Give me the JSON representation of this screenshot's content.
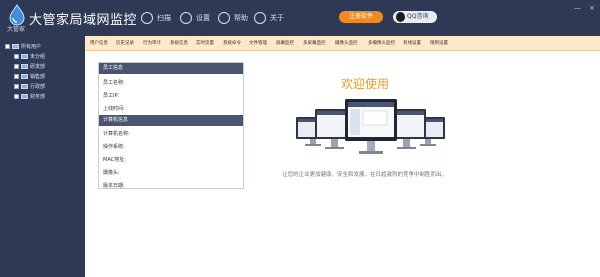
{
  "app": {
    "title": "大管家局域网监控",
    "logo_sub": "大管家"
  },
  "toolbar": {
    "scan": "扫描",
    "settings": "设置",
    "help": "帮助",
    "about": "关于",
    "register": "注册软件",
    "qq": "QQ咨询"
  },
  "window_controls": {
    "minimize": "—",
    "close": "×"
  },
  "tree": {
    "root": "所有用户",
    "items": [
      "未分组",
      "研发部",
      "销售部",
      "行政部",
      "财务部"
    ]
  },
  "tabs": [
    "用户信息",
    "历史记录",
    "行为审计",
    "系统信息",
    "实时流量",
    "系统命令",
    "文件管理",
    "屏幕监控",
    "多屏幕监控",
    "摄像头监控",
    "多摄像头监控",
    "有线设置",
    "限制设置"
  ],
  "panel": {
    "employee_header": "员工信息",
    "employee_fields": [
      "员工名称:",
      "员工IP:",
      "上线时间:"
    ],
    "computer_header": "计算机信息",
    "computer_fields": [
      "计算机名称:",
      "操作系统:",
      "MAC地址:",
      "摄像头:",
      "版本日期:"
    ]
  },
  "welcome": {
    "heading": "欢迎使用",
    "slogan": "让您的企业更加健康、安全和发展，在日趋激烈的竞争中制胜而出。"
  },
  "colors": {
    "titlebar": "#2e3a55",
    "tabbar": "#fde9c8",
    "accent": "#f39a22",
    "register": "#f08a1c"
  }
}
